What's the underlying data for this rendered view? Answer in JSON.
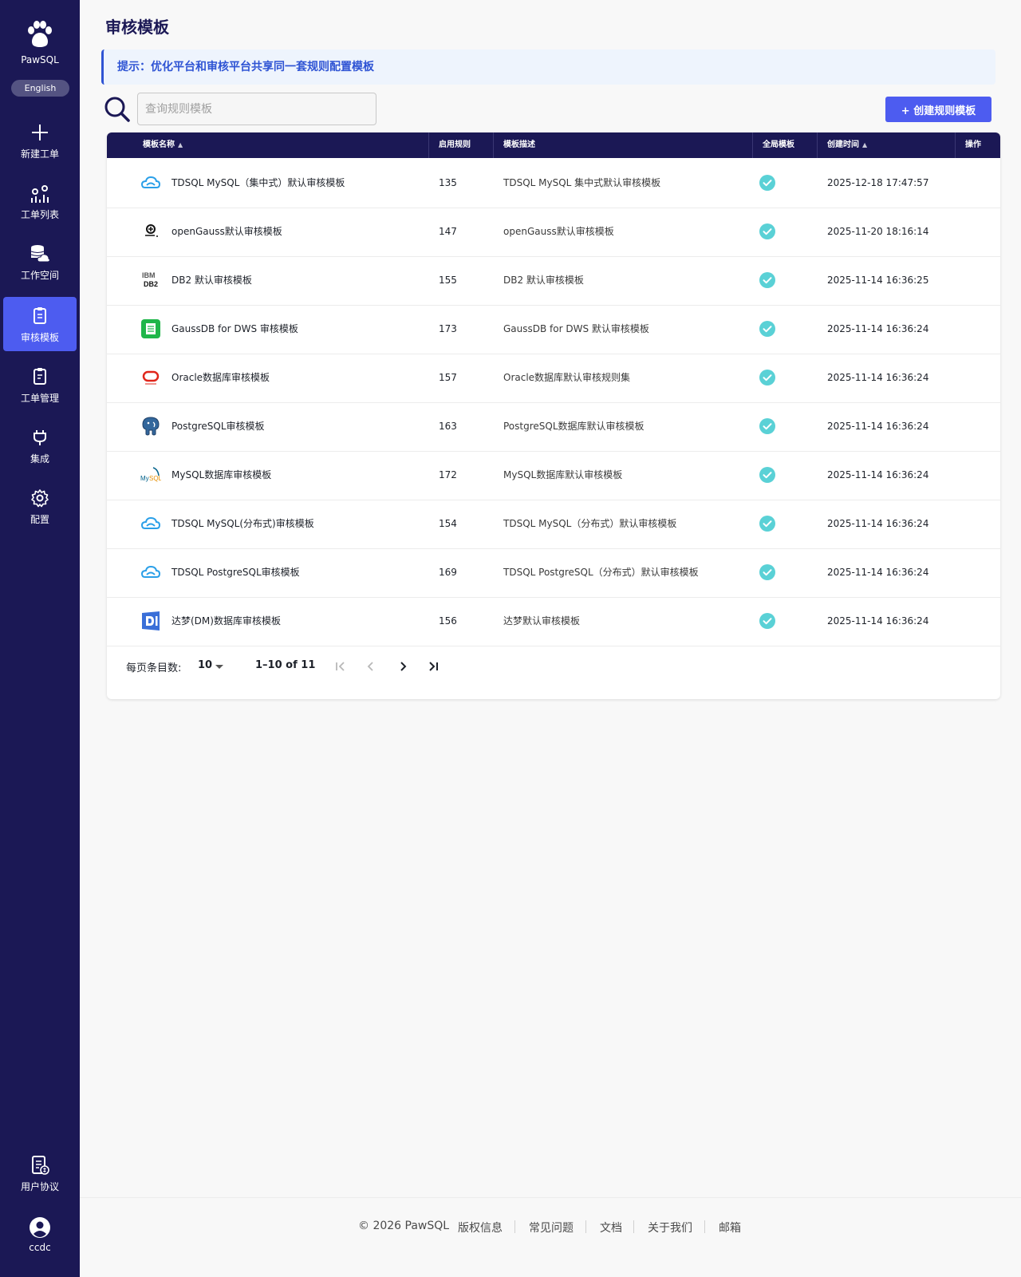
{
  "sidebar": {
    "brand": "PawSQL",
    "lang_button": "English",
    "items": [
      {
        "label": "新建工单",
        "icon": "plus-icon"
      },
      {
        "label": "工单列表",
        "icon": "list-analytics-icon"
      },
      {
        "label": "工作空间",
        "icon": "database-cloud-icon"
      },
      {
        "label": "审核模板",
        "icon": "clipboard-icon"
      },
      {
        "label": "工单管理",
        "icon": "clipboard-manage-icon"
      },
      {
        "label": "集成",
        "icon": "plug-icon"
      },
      {
        "label": "配置",
        "icon": "gear-icon"
      },
      {
        "label": "用户协议",
        "icon": "agreement-icon"
      },
      {
        "label": "ccdc",
        "icon": "user-avatar-icon"
      }
    ]
  },
  "page": {
    "title": "审核模板",
    "tip": "提示：优化平台和审核平台共享同一套规则配置模板",
    "search_placeholder": "查询规则模板",
    "create_button": "+ 创建规则模板"
  },
  "table": {
    "columns": [
      "模板名称",
      "启用规则",
      "模板描述",
      "全局模板",
      "创建时间",
      "操作"
    ],
    "rows": [
      {
        "name": "TDSQL MySQL（集中式）默认审核模板",
        "rules": "135",
        "desc": "TDSQL MySQL 集中式默认审核模板",
        "global": true,
        "created": "2025-12-18 17:47:57",
        "icon": "tdsql-cloud-icon"
      },
      {
        "name": "openGauss默认审核模板",
        "rules": "147",
        "desc": "openGauss默认审核模板",
        "global": true,
        "created": "2025-11-20 18:16:14",
        "icon": "opengauss-icon"
      },
      {
        "name": "DB2 默认审核模板",
        "rules": "155",
        "desc": "DB2 默认审核模板",
        "global": true,
        "created": "2025-11-14 16:36:25",
        "icon": "ibm-db2-icon"
      },
      {
        "name": "GaussDB for DWS 审核模板",
        "rules": "173",
        "desc": "GaussDB for DWS 默认审核模板",
        "global": true,
        "created": "2025-11-14 16:36:24",
        "icon": "gaussdb-dws-icon"
      },
      {
        "name": "Oracle数据库审核模板",
        "rules": "157",
        "desc": "Oracle数据库默认审核规则集",
        "global": true,
        "created": "2025-11-14 16:36:24",
        "icon": "oracle-icon"
      },
      {
        "name": "PostgreSQL审核模板",
        "rules": "163",
        "desc": "PostgreSQL数据库默认审核模板",
        "global": true,
        "created": "2025-11-14 16:36:24",
        "icon": "postgresql-elephant-icon"
      },
      {
        "name": "MySQL数据库审核模板",
        "rules": "172",
        "desc": "MySQL数据库默认审核模板",
        "global": true,
        "created": "2025-11-14 16:36:24",
        "icon": "mysql-dolphin-icon"
      },
      {
        "name": "TDSQL MySQL(分布式)审核模板",
        "rules": "154",
        "desc": "TDSQL MySQL（分布式）默认审核模板",
        "global": true,
        "created": "2025-11-14 16:36:24",
        "icon": "tdsql-cloud-icon"
      },
      {
        "name": "TDSQL PostgreSQL审核模板",
        "rules": "169",
        "desc": "TDSQL PostgreSQL（分布式）默认审核模板",
        "global": true,
        "created": "2025-11-14 16:36:24",
        "icon": "tdsql-cloud-icon"
      },
      {
        "name": "达梦(DM)数据库审核模板",
        "rules": "156",
        "desc": "达梦默认审核模板",
        "global": true,
        "created": "2025-11-14 16:36:24",
        "icon": "dameng-icon"
      }
    ]
  },
  "pagination": {
    "per_page_label": "每页条目数:",
    "per_page_value": "10",
    "range": "1–10 of 11"
  },
  "footer": {
    "copyright": "© 2026 PawSQL",
    "links": [
      "版权信息",
      "常见问题",
      "文档",
      "关于我们",
      "邮箱"
    ]
  },
  "colors": {
    "sidebar": "#1b1855",
    "accent": "#4d5cf0",
    "check": "#5ad1d6",
    "tip_text": "#2f54d4"
  }
}
